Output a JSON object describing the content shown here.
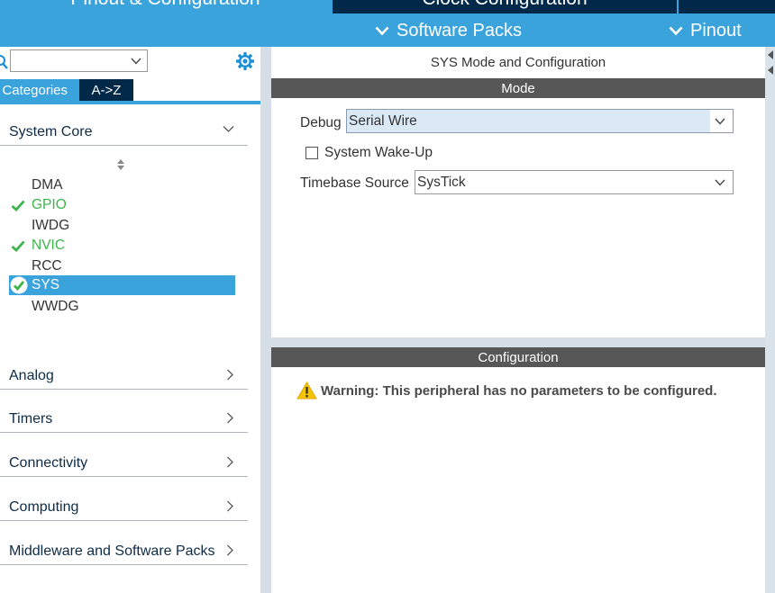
{
  "top_tabs": [
    {
      "label": "Pinout & Configuration"
    },
    {
      "label": "Clock Configuration"
    }
  ],
  "subbar": {
    "software_packs_label": "Software Packs",
    "pinout_label": "Pinout"
  },
  "left_panel": {
    "search": {
      "value": ""
    },
    "tabs": {
      "categories": "Categories",
      "az": "A->Z"
    },
    "system_core": {
      "label": "System Core",
      "items": [
        {
          "label": "DMA",
          "status": "none"
        },
        {
          "label": "GPIO",
          "status": "ok"
        },
        {
          "label": "IWDG",
          "status": "none"
        },
        {
          "label": "NVIC",
          "status": "ok"
        },
        {
          "label": "RCC",
          "status": "none"
        },
        {
          "label": "SYS",
          "status": "selected"
        },
        {
          "label": "WWDG",
          "status": "none"
        }
      ]
    },
    "categories": [
      {
        "label": "Analog"
      },
      {
        "label": "Timers"
      },
      {
        "label": "Connectivity"
      },
      {
        "label": "Computing"
      },
      {
        "label": "Middleware and Software Packs"
      }
    ]
  },
  "right_panel": {
    "title": "SYS Mode and Configuration",
    "mode_header": "Mode",
    "debug": {
      "label": "Debug",
      "value": "Serial Wire"
    },
    "wakeup": {
      "label": "System Wake-Up",
      "checked": false
    },
    "timebase": {
      "label": "Timebase Source",
      "value": "SysTick"
    },
    "config_header": "Configuration",
    "warning": "Warning: This peripheral has no parameters to be configured."
  },
  "colors": {
    "accent": "#3ba3dc",
    "dark_navy": "#002849",
    "section_bar": "#575757",
    "ok_green": "#3cb44b",
    "warning_yellow": "#f5c400"
  }
}
